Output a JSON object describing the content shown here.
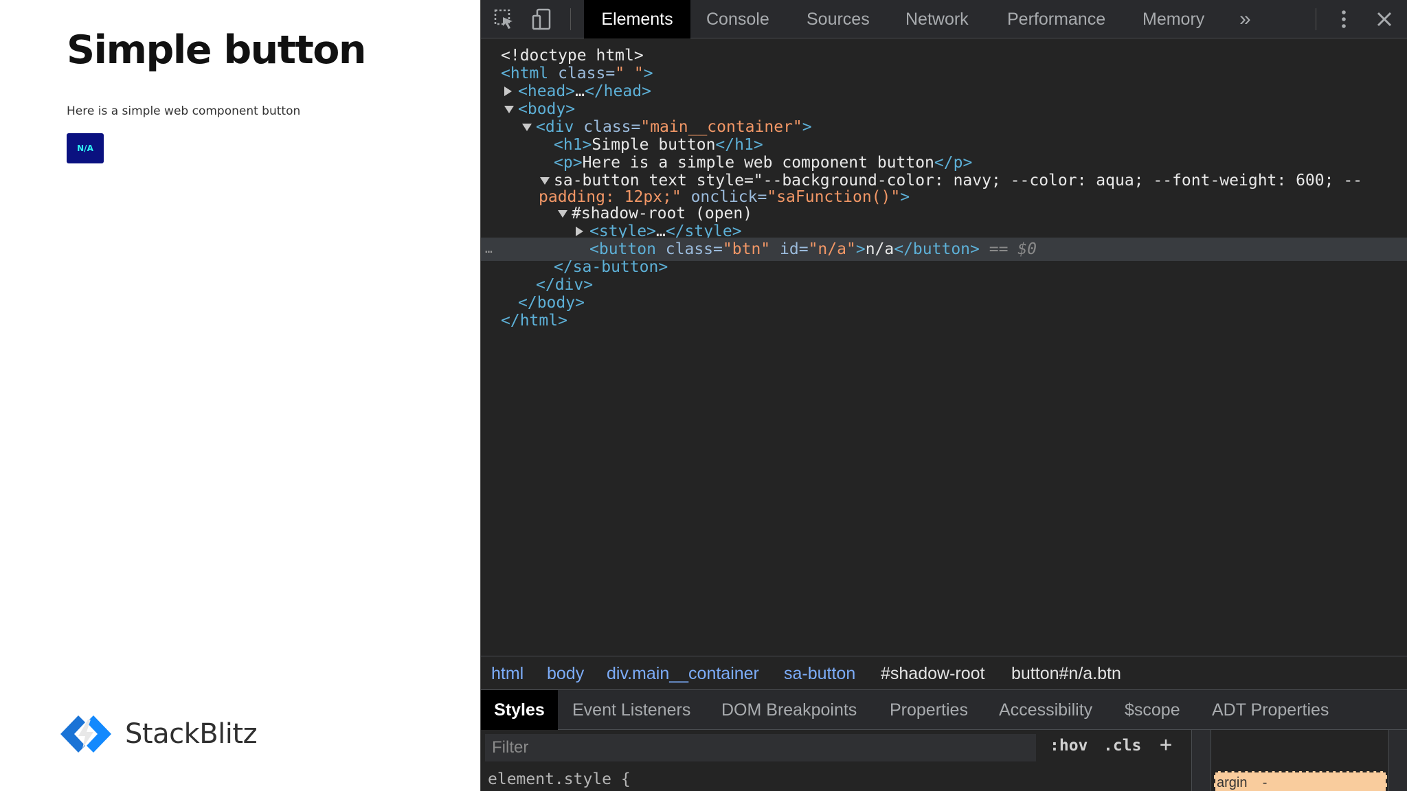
{
  "preview": {
    "heading": "Simple button",
    "paragraph": "Here is a simple web component button",
    "button_label": "N/A",
    "brand_name": "StackBlitz",
    "button_bg": "#0a1180",
    "button_fg": "#2ff3f3"
  },
  "devtools": {
    "toolbar": {
      "icons": [
        "inspect-element-icon",
        "device-toolbar-icon",
        "more-tabs-icon",
        "kebab-menu-icon",
        "close-icon"
      ],
      "tabs": [
        "Elements",
        "Console",
        "Sources",
        "Network",
        "Performance",
        "Memory"
      ],
      "active_tab": "Elements",
      "overflow_label": "»"
    },
    "dom": [
      {
        "lines": [
          "<!doctype html>"
        ]
      },
      {
        "lines": [
          "<html class=\" \">"
        ]
      },
      {
        "lines": [
          "<head>…</head>"
        ]
      },
      {
        "lines": [
          "<body>"
        ]
      },
      {
        "lines": [
          "<div class=\"main__container\">"
        ]
      },
      {
        "lines": [
          "<h1>Simple button</h1>"
        ]
      },
      {
        "lines": [
          "<p>Here is a simple web component button</p>"
        ]
      },
      {
        "lines": [
          "<sa-button text style=\"--background-color: navy; --color: aqua; --font-weight: 600; --",
          "padding: 12px;\" onclick=\"saFunction()\">"
        ]
      },
      {
        "lines": [
          "#shadow-root (open)"
        ]
      },
      {
        "lines": [
          "<style>…</style>"
        ]
      },
      {
        "lines": [
          "<button class=\"btn\" id=\"n/a\">n/a</button> == $0"
        ]
      },
      {
        "lines": [
          "</sa-button>"
        ]
      },
      {
        "lines": [
          "</div>"
        ]
      },
      {
        "lines": [
          "</body>"
        ]
      },
      {
        "lines": [
          "</html>"
        ]
      }
    ],
    "selected_marker": "…",
    "breadcrumbs": [
      "html",
      "body",
      "div.main__container",
      "sa-button",
      "#shadow-root",
      "button#n/a.btn"
    ],
    "subtabs": [
      "Styles",
      "Event Listeners",
      "DOM Breakpoints",
      "Properties",
      "Accessibility",
      "$scope",
      "ADT Properties"
    ],
    "active_subtab": "Styles",
    "filter_placeholder": "Filter",
    "filter_hov": ":hov",
    "filter_cls": ".cls",
    "filter_add": "+",
    "style_rule": "element.style {",
    "box_model_label": "argin    -"
  }
}
